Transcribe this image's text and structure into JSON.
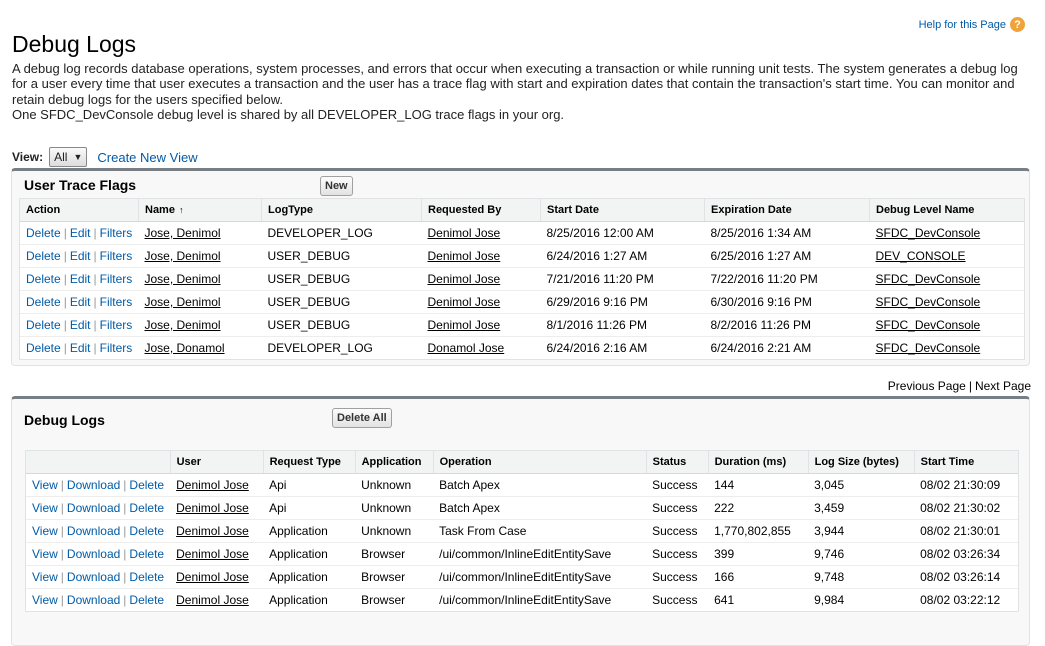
{
  "header": {
    "title": "Debug Logs",
    "help_label": "Help for this Page",
    "help_icon": "?"
  },
  "description": [
    "A debug log records database operations, system processes, and errors that occur when executing a transaction or while running unit tests. The system generates a debug log for a user every time that user executes a transaction and the user has a trace flag with start and expiration dates that contain the transaction's start time. You can monitor and retain debug logs for the users specified below.",
    "One SFDC_DevConsole debug level is shared by all DEVELOPER_LOG trace flags in your org."
  ],
  "view": {
    "label": "View:",
    "selected": "All",
    "create_link": "Create New View"
  },
  "trace_flags": {
    "title": "User Trace Flags",
    "new_button": "New",
    "columns": [
      "Action",
      "Name",
      "LogType",
      "Requested By",
      "Start Date",
      "Expiration Date",
      "Debug Level Name"
    ],
    "actions": [
      "Delete",
      "Edit",
      "Filters"
    ],
    "rows": [
      {
        "name": "Jose, Denimol",
        "log_type": "DEVELOPER_LOG",
        "requested_by": "Denimol Jose",
        "start": "8/25/2016 12:00 AM",
        "expiration": "8/25/2016 1:34 AM",
        "level": "SFDC_DevConsole"
      },
      {
        "name": "Jose, Denimol",
        "log_type": "USER_DEBUG",
        "requested_by": "Denimol Jose",
        "start": "6/24/2016 1:27 AM",
        "expiration": "6/25/2016 1:27 AM",
        "level": "DEV_CONSOLE"
      },
      {
        "name": "Jose, Denimol",
        "log_type": "USER_DEBUG",
        "requested_by": "Denimol Jose",
        "start": "7/21/2016 11:20 PM",
        "expiration": "7/22/2016 11:20 PM",
        "level": "SFDC_DevConsole"
      },
      {
        "name": "Jose, Denimol",
        "log_type": "USER_DEBUG",
        "requested_by": "Denimol Jose",
        "start": "6/29/2016 9:16 PM",
        "expiration": "6/30/2016 9:16 PM",
        "level": "SFDC_DevConsole"
      },
      {
        "name": "Jose, Denimol",
        "log_type": "USER_DEBUG",
        "requested_by": "Denimol Jose",
        "start": "8/1/2016 11:26 PM",
        "expiration": "8/2/2016 11:26 PM",
        "level": "SFDC_DevConsole"
      },
      {
        "name": "Jose, Donamol",
        "log_type": "DEVELOPER_LOG",
        "requested_by": "Donamol Jose",
        "start": "6/24/2016 2:16 AM",
        "expiration": "6/24/2016 2:21 AM",
        "level": "SFDC_DevConsole"
      }
    ]
  },
  "pager": {
    "previous": "Previous Page",
    "next": "Next Page"
  },
  "debug_logs": {
    "title": "Debug Logs",
    "delete_all_button": "Delete All",
    "columns": [
      "",
      "User",
      "Request Type",
      "Application",
      "Operation",
      "Status",
      "Duration (ms)",
      "Log Size (bytes)",
      "Start Time"
    ],
    "actions": [
      "View",
      "Download",
      "Delete"
    ],
    "rows": [
      {
        "user": "Denimol Jose",
        "request_type": "Api",
        "application": "Unknown",
        "operation": "Batch Apex",
        "status": "Success",
        "duration": "144",
        "size": "3,045",
        "start": "08/02 21:30:09"
      },
      {
        "user": "Denimol Jose",
        "request_type": "Api",
        "application": "Unknown",
        "operation": "Batch Apex",
        "status": "Success",
        "duration": "222",
        "size": "3,459",
        "start": "08/02 21:30:02"
      },
      {
        "user": "Denimol Jose",
        "request_type": "Application",
        "application": "Unknown",
        "operation": "Task From Case",
        "status": "Success",
        "duration": "1,770,802,855",
        "size": "3,944",
        "start": "08/02 21:30:01"
      },
      {
        "user": "Denimol Jose",
        "request_type": "Application",
        "application": "Browser",
        "operation": "/ui/common/InlineEditEntitySave",
        "status": "Success",
        "duration": "399",
        "size": "9,746",
        "start": "08/02 03:26:34"
      },
      {
        "user": "Denimol Jose",
        "request_type": "Application",
        "application": "Browser",
        "operation": "/ui/common/InlineEditEntitySave",
        "status": "Success",
        "duration": "166",
        "size": "9,748",
        "start": "08/02 03:26:14"
      },
      {
        "user": "Denimol Jose",
        "request_type": "Application",
        "application": "Browser",
        "operation": "/ui/common/InlineEditEntitySave",
        "status": "Success",
        "duration": "641",
        "size": "9,984",
        "start": "08/02 03:22:12"
      }
    ]
  }
}
